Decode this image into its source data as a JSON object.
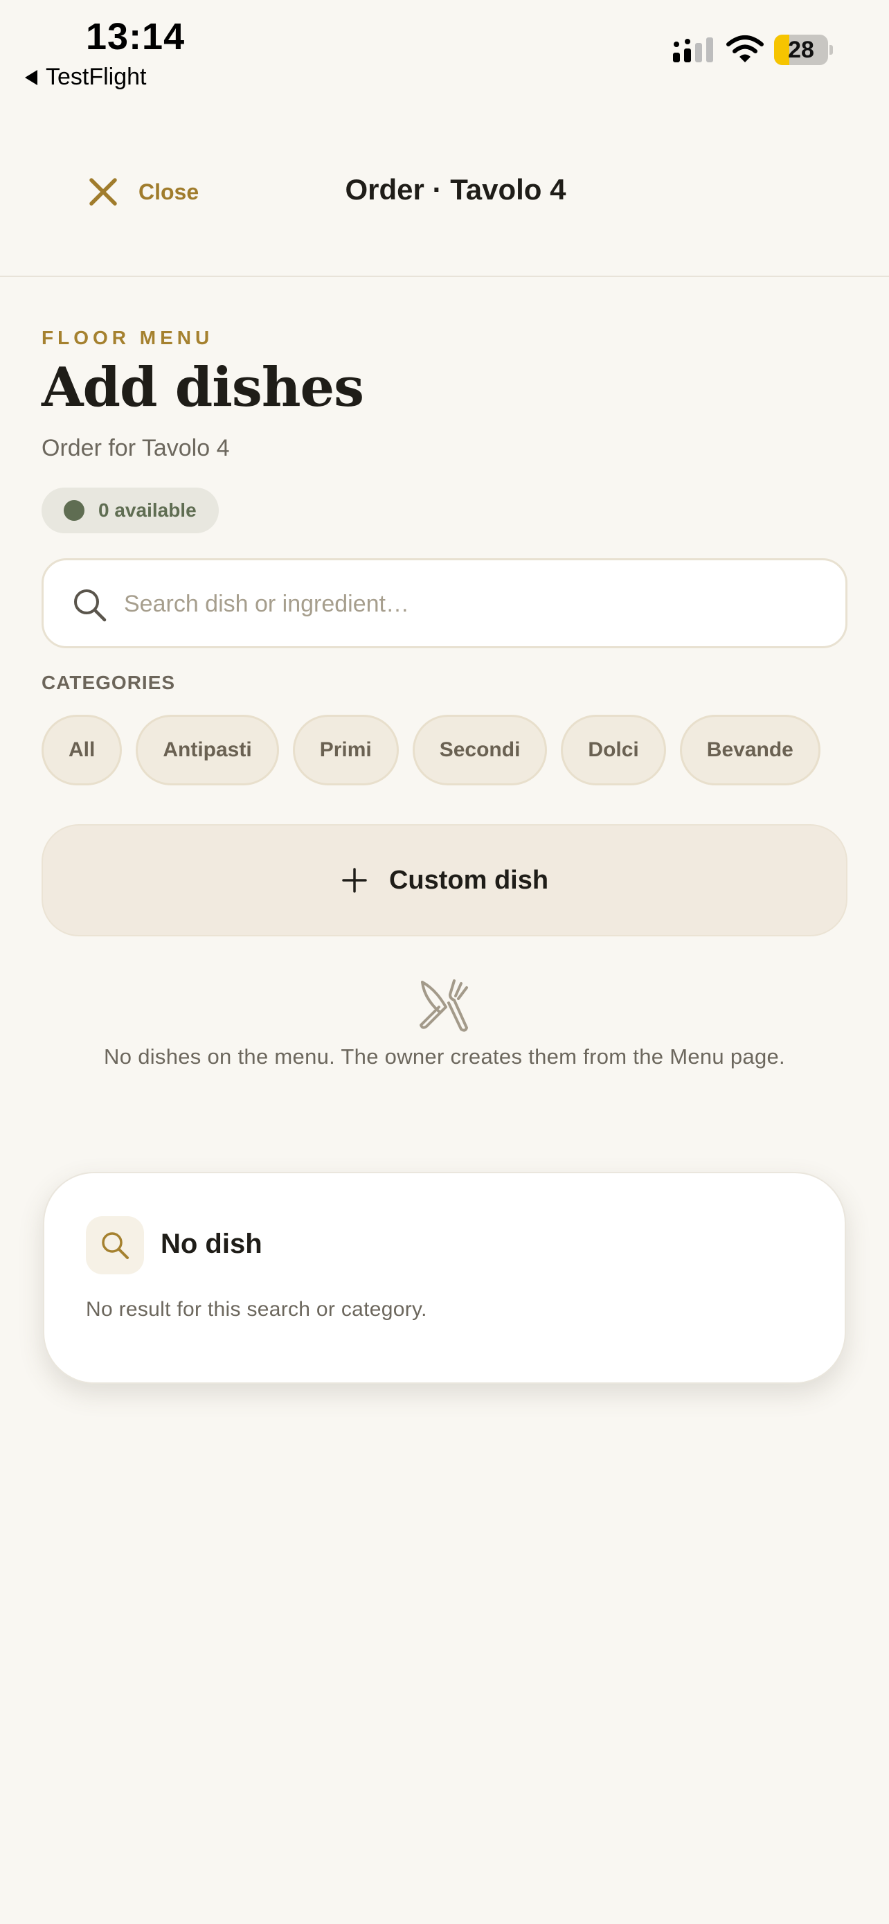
{
  "status_bar": {
    "time": "13:14",
    "back_app": "TestFlight",
    "battery_level": "28",
    "battery_color": "#f6c400"
  },
  "navbar": {
    "close_label": "Close",
    "title": "Order · Tavolo 4",
    "accent": "#a07c2c"
  },
  "header": {
    "eyebrow": "FLOOR MENU",
    "title": "Add dishes",
    "subtitle": "Order for Tavolo 4",
    "availability": "0 available"
  },
  "search": {
    "placeholder": "Search dish or ingredient…",
    "value": ""
  },
  "categories": {
    "label": "CATEGORIES",
    "items": [
      "All",
      "Antipasti",
      "Primi",
      "Secondi",
      "Dolci",
      "Bevande"
    ]
  },
  "custom_dish": {
    "label": "Custom dish"
  },
  "empty_state": {
    "icon": "utensils-icon",
    "message": "No dishes on the menu. The owner creates them from the Menu page."
  },
  "no_result_card": {
    "icon": "search-icon",
    "title": "No dish",
    "description": "No result for this search or category."
  }
}
